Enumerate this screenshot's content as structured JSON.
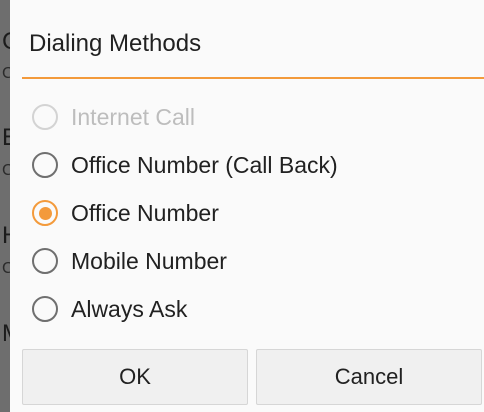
{
  "dialog": {
    "title": "Dialing Methods",
    "options": [
      {
        "label": "Internet Call",
        "state": "disabled"
      },
      {
        "label": "Office Number (Call Back)",
        "state": "unchecked"
      },
      {
        "label": "Office Number",
        "state": "checked"
      },
      {
        "label": "Mobile Number",
        "state": "unchecked"
      },
      {
        "label": "Always Ask",
        "state": "unchecked"
      }
    ],
    "ok_label": "OK",
    "cancel_label": "Cancel"
  },
  "colors": {
    "accent": "#f39a3b",
    "dialog_background": "#fafafa",
    "button_background": "#f0f0f0"
  }
}
